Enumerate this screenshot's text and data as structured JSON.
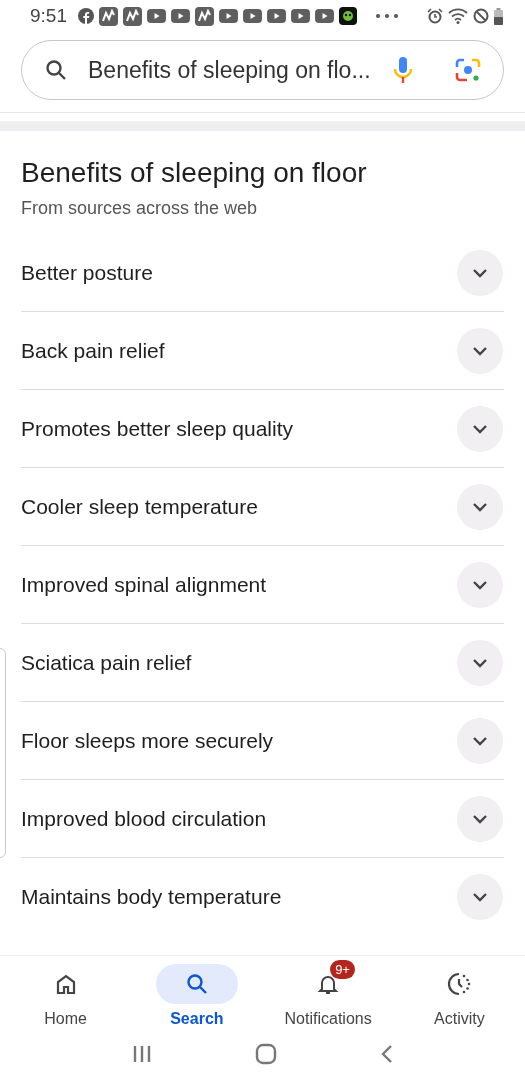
{
  "status_bar": {
    "time": "9:51"
  },
  "search": {
    "value": "Benefits of sleeping on flo..."
  },
  "section": {
    "title": "Benefits of sleeping on floor",
    "subtitle": "From sources across the web"
  },
  "items": [
    {
      "label": "Better posture",
      "expanded": false
    },
    {
      "label": "Back pain relief",
      "expanded": false
    },
    {
      "label": "Promotes better sleep quality",
      "expanded": false
    },
    {
      "label": "Cooler sleep temperature",
      "expanded": false
    },
    {
      "label": "Improved spinal alignment",
      "expanded": false
    },
    {
      "label": "Sciatica pain relief",
      "expanded": false
    },
    {
      "label": "Floor sleeps more securely",
      "expanded": false
    },
    {
      "label": "Improved blood circulation",
      "expanded": false
    },
    {
      "label": "Maintains body temperature",
      "expanded": false
    }
  ],
  "nav": [
    {
      "kind": "home",
      "label": "Home",
      "selected": false
    },
    {
      "kind": "search",
      "label": "Search",
      "selected": true
    },
    {
      "kind": "notifications",
      "label": "Notifications",
      "selected": false,
      "badge": "9+"
    },
    {
      "kind": "activity",
      "label": "Activity",
      "selected": false
    }
  ]
}
